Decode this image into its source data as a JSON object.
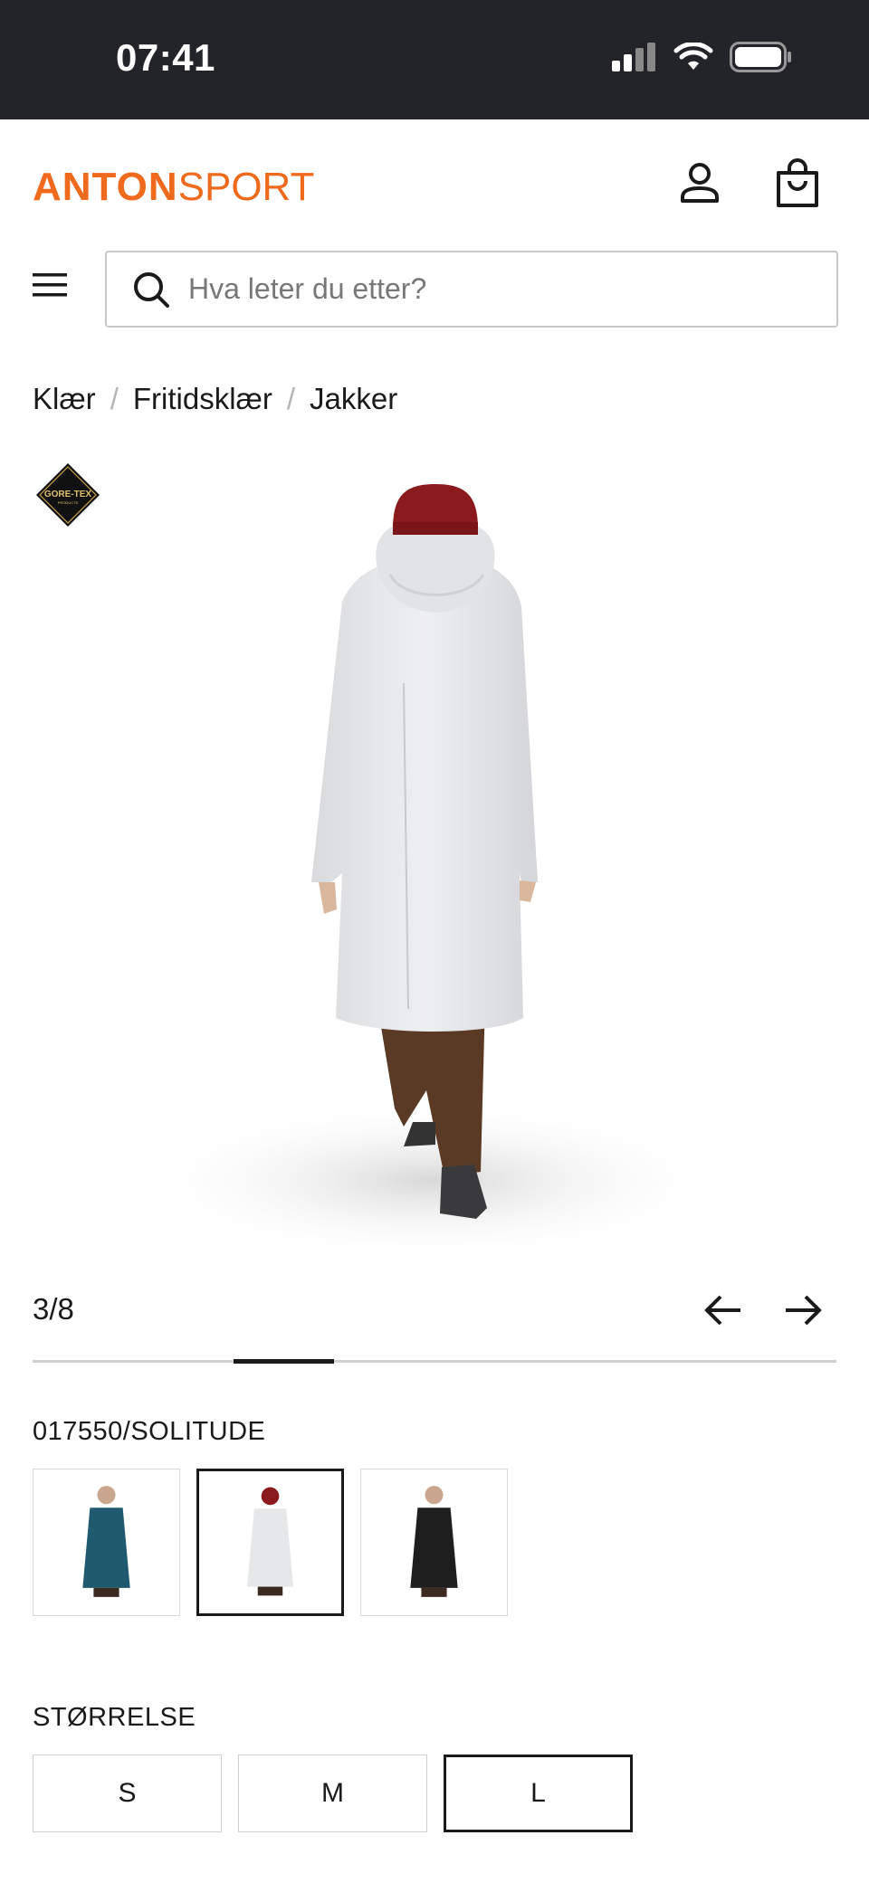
{
  "status_bar": {
    "time": "07:41"
  },
  "header": {
    "logo_bold": "ANTON",
    "logo_light": "SPORT",
    "brand_color": "#ef6a1c",
    "account_icon": "user-icon",
    "cart_icon": "shopping-bag-icon"
  },
  "search": {
    "placeholder": "Hva leter du etter?",
    "value": ""
  },
  "breadcrumb": {
    "items": [
      "Klær",
      "Fritidsklær",
      "Jakker"
    ],
    "separator": "/"
  },
  "product": {
    "badge": "GORE-TEX",
    "badge_sub": "PRODUCTS",
    "gallery": {
      "counter": "3/8",
      "current": 3,
      "total": 8
    },
    "color_label": "017550/SOLITUDE",
    "colors": [
      {
        "name": "teal",
        "coat": "#1f5a6e",
        "selected": false
      },
      {
        "name": "solitude",
        "coat": "#e6e7e9",
        "selected": true
      },
      {
        "name": "black",
        "coat": "#1e1e1e",
        "selected": false
      }
    ],
    "size_label": "STØRRELSE",
    "sizes": [
      {
        "label": "S",
        "selected": false
      },
      {
        "label": "M",
        "selected": false
      },
      {
        "label": "L",
        "selected": true
      }
    ]
  }
}
